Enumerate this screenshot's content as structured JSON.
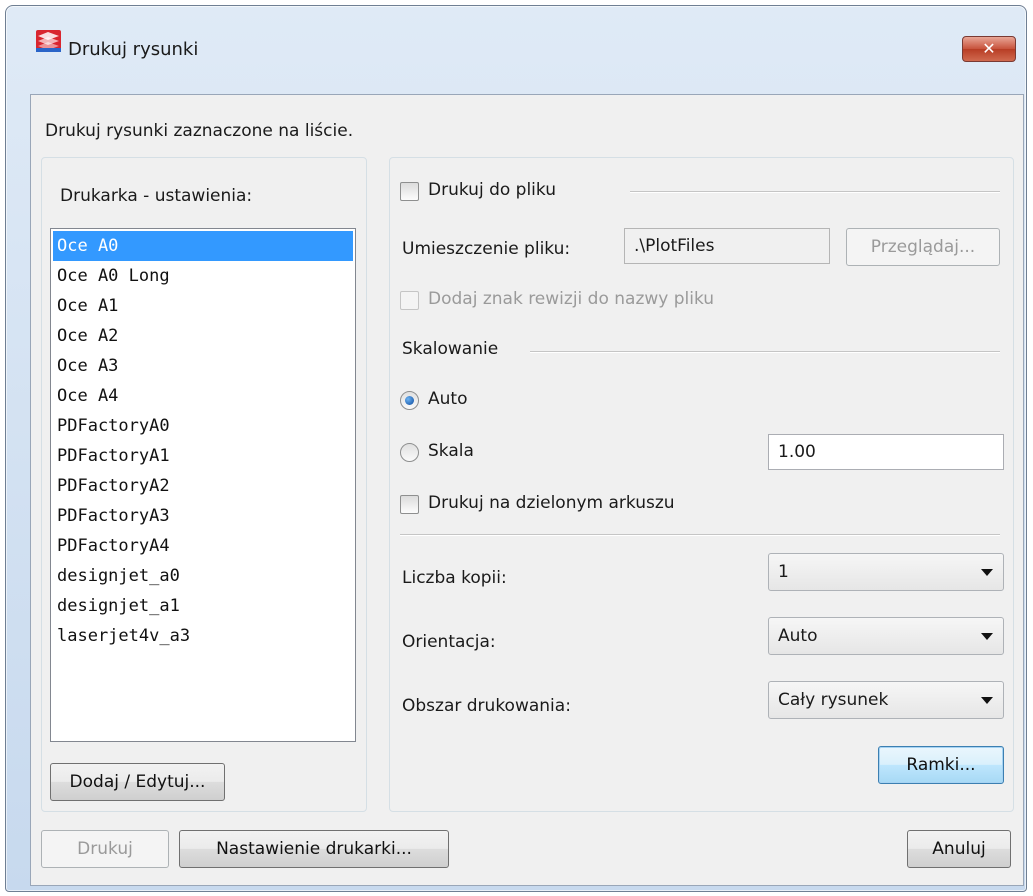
{
  "window": {
    "title": "Drukuj rysunki",
    "close_symbol": "✕"
  },
  "description": "Drukuj rysunki zaznaczone na liście.",
  "left_panel": {
    "label": "Drukarka - ustawienia:",
    "printers": [
      "Oce A0",
      "Oce A0 Long",
      "Oce A1",
      "Oce A2",
      "Oce A3",
      "Oce A4",
      "PDFactoryA0",
      "PDFactoryA1",
      "PDFactoryA2",
      "PDFactoryA3",
      "PDFactoryA4",
      "designjet_a0",
      "designjet_a1",
      "laserjet4v_a3"
    ],
    "selected_printer": "Oce A0",
    "add_edit_button": "Dodaj / Edytuj..."
  },
  "right_panel": {
    "print_to_file": {
      "label": "Drukuj do pliku",
      "checked": false
    },
    "file_location": {
      "label": "Umieszczenie pliku:",
      "value": ".\\PlotFiles",
      "browse_button": "Przeglądaj..."
    },
    "add_revision": {
      "label": "Dodaj znak rewizji do nazwy pliku",
      "checked": false,
      "enabled": false
    },
    "scaling": {
      "label": "Skalowanie",
      "auto_label": "Auto",
      "scale_label": "Skala",
      "selected": "Auto",
      "scale_value": "1.00"
    },
    "tiled_sheet": {
      "label": "Drukuj na dzielonym arkuszu",
      "checked": false
    },
    "copies": {
      "label": "Liczba kopii:",
      "value": "1"
    },
    "orientation": {
      "label": "Orientacja:",
      "value": "Auto"
    },
    "print_area": {
      "label": "Obszar drukowania:",
      "value": "Cały rysunek"
    },
    "frames_button": "Ramki..."
  },
  "footer": {
    "print_button": "Drukuj",
    "printer_setup_button": "Nastawienie drukarki...",
    "cancel_button": "Anuluj"
  },
  "colors": {
    "selection": "#3399ff",
    "title_bar": "#c7d9ee",
    "close_button": "#c7513b",
    "dialog_background": "#f0f0f0"
  }
}
